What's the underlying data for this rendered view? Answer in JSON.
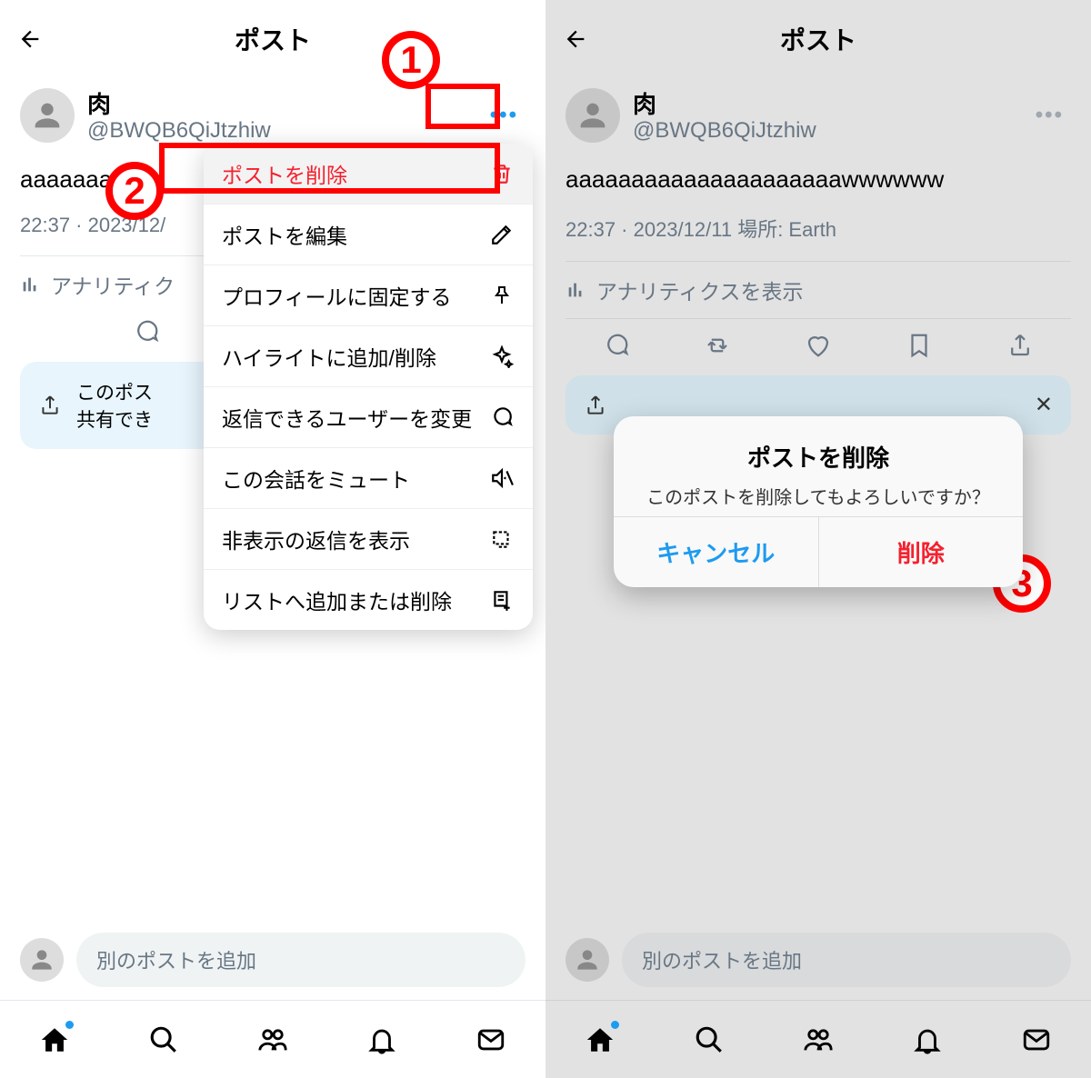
{
  "header": {
    "title": "ポスト"
  },
  "user": {
    "name": "肉",
    "handle": "@BWQB6QiJtzhiw"
  },
  "post": {
    "body_left": "aaaaaaaa",
    "body_right": "aaaaaaaaaaaaaaaaaaaaawwwwww"
  },
  "meta": {
    "left": "22:37 · 2023/12/",
    "right": "22:37 · 2023/12/11 場所: Earth"
  },
  "analytics": {
    "left": "アナリティク",
    "right": "アナリティクスを表示"
  },
  "promo": {
    "left_line1": "このポス",
    "left_line2": "共有でき"
  },
  "menu": {
    "items": [
      "ポストを削除",
      "ポストを編集",
      "プロフィールに固定する",
      "ハイライトに追加/削除",
      "返信できるユーザーを変更",
      "この会話をミュート",
      "非表示の返信を表示",
      "リストへ追加または削除"
    ]
  },
  "dialog": {
    "title": "ポストを削除",
    "message": "このポストを削除してもよろしいですか？",
    "cancel": "キャンセル",
    "delete": "削除"
  },
  "addbar": {
    "placeholder": "別のポストを追加"
  },
  "ann": {
    "one": "1",
    "two": "2",
    "three": "3"
  }
}
